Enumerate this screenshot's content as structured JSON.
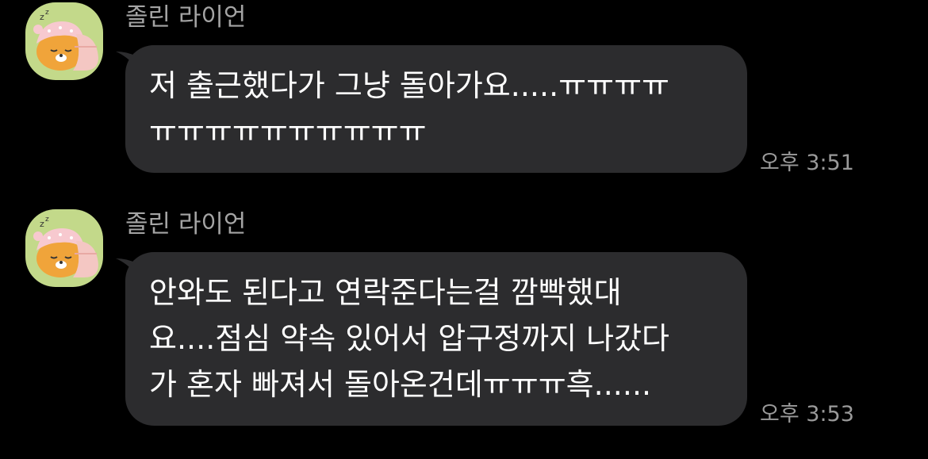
{
  "colors": {
    "background": "#000000",
    "bubble": "#2c2c2e",
    "sender_name": "#a4a4a4",
    "timestamp": "#9a9a9a",
    "avatar_bg": "#c3d98a"
  },
  "messages": [
    {
      "sender": "졸린 라이언",
      "avatar_icon": "sleepy-ryan-icon",
      "lines": [
        "저 출근했다가 그냥 돌아가요.....ㅠㅠㅠㅠ",
        "ㅠㅠㅠㅠㅠㅠㅠㅠㅠㅠ"
      ],
      "time": "오후 3:51"
    },
    {
      "sender": "졸린 라이언",
      "avatar_icon": "sleepy-ryan-icon",
      "lines": [
        "안와도 된다고 연락준다는걸 깜빡했대",
        "요....점심 약속 있어서 압구정까지 나갔다",
        "가 혼자 빠져서 돌아온건데ㅠㅠㅠ흑......"
      ],
      "time": "오후 3:53"
    }
  ]
}
